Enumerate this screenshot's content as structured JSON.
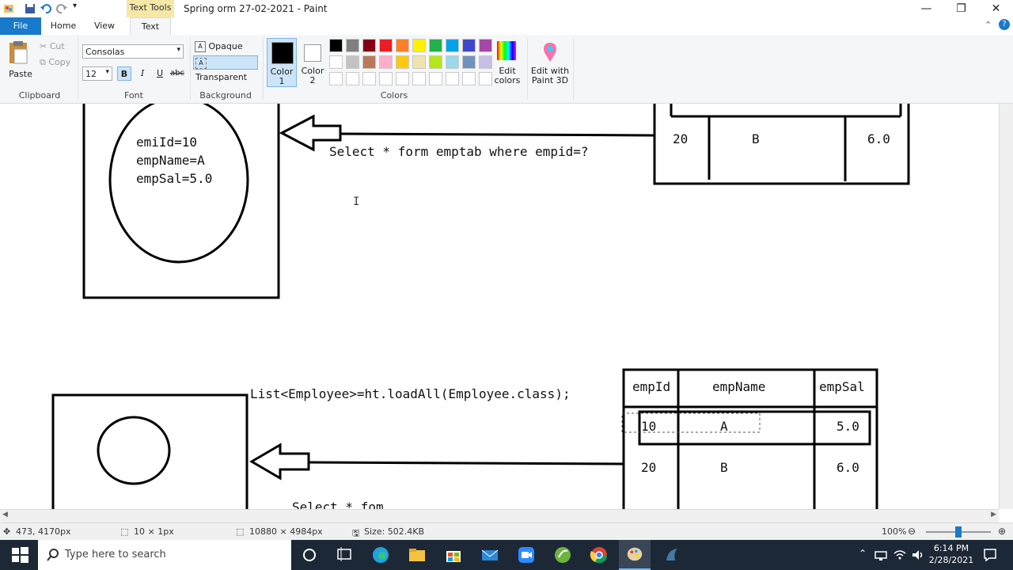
{
  "window": {
    "contextual_tab": "Text Tools",
    "title": "Spring orm  27-02-2021 - Paint"
  },
  "tabs": [
    "File",
    "Home",
    "View",
    "Text"
  ],
  "ribbon": {
    "clipboard": {
      "paste": "Paste",
      "cut": "Cut",
      "copy": "Copy",
      "label": "Clipboard"
    },
    "font": {
      "family": "Consolas",
      "size": "12",
      "bold": "B",
      "italic": "I",
      "underline": "U",
      "strike": "abc",
      "label": "Font"
    },
    "background": {
      "opaque": "Opaque",
      "transparent": "Transparent",
      "label": "Background"
    },
    "colors": {
      "color1_line1": "Color",
      "color1_line2": "1",
      "color2_line1": "Color",
      "color2_line2": "2",
      "edit_line1": "Edit",
      "edit_line2": "colors",
      "paint3d_line1": "Edit with",
      "paint3d_line2": "Paint 3D",
      "label": "Colors",
      "color1_value": "#000000",
      "color2_value": "#ffffff",
      "palette_row1": [
        "#000000",
        "#7f7f7f",
        "#880015",
        "#ed1c24",
        "#ff7f27",
        "#fff200",
        "#22b14c",
        "#00a2e8",
        "#3f48cc",
        "#a349a4"
      ],
      "palette_row2": [
        "#ffffff",
        "#c3c3c3",
        "#b97a57",
        "#ffaec9",
        "#ffc90e",
        "#efe4b0",
        "#b5e61d",
        "#99d9ea",
        "#7092be",
        "#c8bfe7"
      ],
      "palette_row3": [
        "#ffffff",
        "#ffffff",
        "#ffffff",
        "#ffffff",
        "#ffffff",
        "#ffffff",
        "#ffffff",
        "#ffffff",
        "#ffffff",
        "#ffffff"
      ]
    }
  },
  "canvas": {
    "top_object": {
      "line1": "emiId=10",
      "line2": "empName=A",
      "line3": "empSal=5.0"
    },
    "top_query": "Select * form emptab where empid=?",
    "top_table_row": {
      "id": "20",
      "name": "B",
      "sal": "6.0"
    },
    "bottom_query": "List<Employee>=ht.loadAll(Employee.class);",
    "bottom_table": {
      "headers": [
        "empId",
        "empName",
        "empSal"
      ],
      "row1": {
        "id": "10",
        "name": "A",
        "sal": "5.0"
      },
      "row2": {
        "id": "20",
        "name": "B",
        "sal": "6.0"
      }
    },
    "partial_text": "Select * fom"
  },
  "status": {
    "cursor_pos": "473, 4170px",
    "selection_size": "10 × 1px",
    "image_size": "10880 × 4984px",
    "file_size": "Size: 502.4KB",
    "zoom": "100%",
    "zoom_fraction": 0.5
  },
  "taskbar": {
    "search_placeholder": "Type here to search",
    "time": "6:14 PM",
    "date": "2/28/2021"
  }
}
